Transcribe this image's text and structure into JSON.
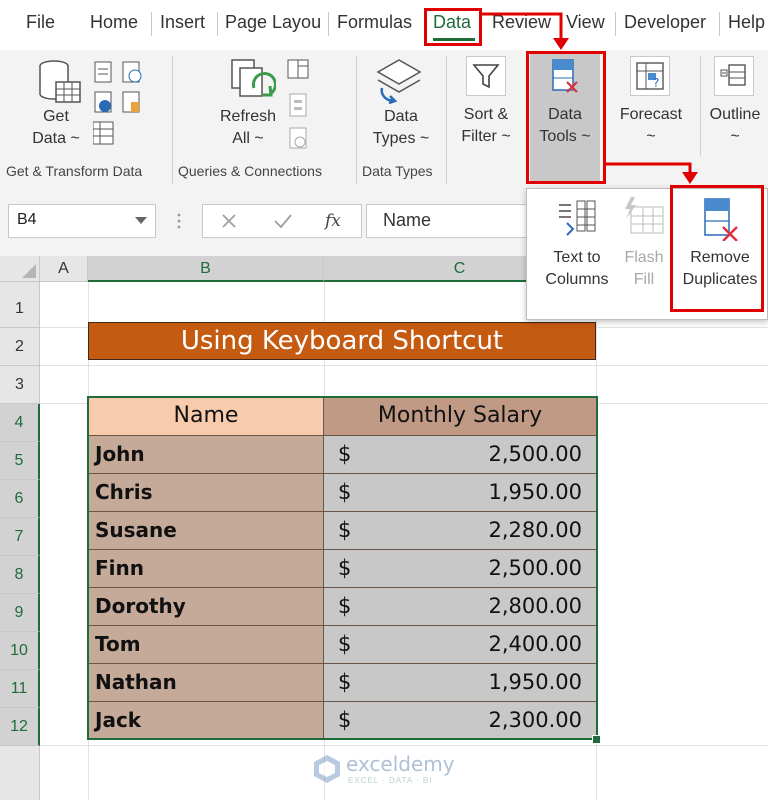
{
  "ribbon_tabs": [
    "File",
    "Home",
    "Insert",
    "Page Layou",
    "Formulas",
    "Data",
    "Review",
    "View",
    "Developer",
    "Help"
  ],
  "active_tab": "Data",
  "groups": {
    "get_transform": {
      "label": "Get & Transform Data",
      "get_data": {
        "line1": "Get",
        "line2": "Data ~"
      }
    },
    "queries": {
      "label": "Queries & Connections",
      "refresh_all": {
        "line1": "Refresh",
        "line2": "All ~"
      }
    },
    "data_types": {
      "label": "Data Types",
      "data_types_btn": {
        "line1": "Data",
        "line2": "Types ~"
      }
    },
    "sort_filter": {
      "line1": "Sort &",
      "line2": "Filter ~"
    },
    "data_tools": {
      "line1": "Data",
      "line2": "Tools ~"
    },
    "forecast": {
      "line1": "Forecast",
      "line2": "~"
    },
    "outline": {
      "line1": "Outline",
      "line2": "~"
    }
  },
  "formula_bar": {
    "name_box": "B4",
    "fx_symbol": "fx",
    "content": "Name"
  },
  "dropdown": {
    "text_to_columns": {
      "line1": "Text to",
      "line2": "Columns"
    },
    "flash_fill": {
      "line1": "Flash",
      "line2": "Fill"
    },
    "remove_duplicates": {
      "line1": "Remove",
      "line2": "Duplicates"
    }
  },
  "columns": [
    "A",
    "B",
    "C"
  ],
  "rows": [
    "1",
    "2",
    "3",
    "4",
    "5",
    "6",
    "7",
    "8",
    "9",
    "10",
    "11",
    "12"
  ],
  "sheet": {
    "title": "Using Keyboard Shortcut",
    "headers": [
      "Name",
      "Monthly Salary"
    ],
    "currency_symbol": "$",
    "records": [
      {
        "name": "John",
        "salary": "2,500.00"
      },
      {
        "name": "Chris",
        "salary": "1,950.00"
      },
      {
        "name": "Susane",
        "salary": "2,280.00"
      },
      {
        "name": "Finn",
        "salary": "2,500.00"
      },
      {
        "name": "Dorothy",
        "salary": "2,800.00"
      },
      {
        "name": "Tom",
        "salary": "2,400.00"
      },
      {
        "name": "Nathan",
        "salary": "1,950.00"
      },
      {
        "name": "Jack",
        "salary": "2,300.00"
      }
    ]
  },
  "watermark": {
    "name": "exceldemy",
    "tagline": "EXCEL · DATA · BI"
  },
  "colors": {
    "excel_green": "#1f6b3a",
    "title_fill": "#c55a11",
    "header_name_fill": "#f8cbad",
    "header_salary_fill": "#c09a84",
    "name_fill": "#c5a999",
    "salary_fill": "#c8c8c8",
    "highlight_red": "#e00000"
  }
}
